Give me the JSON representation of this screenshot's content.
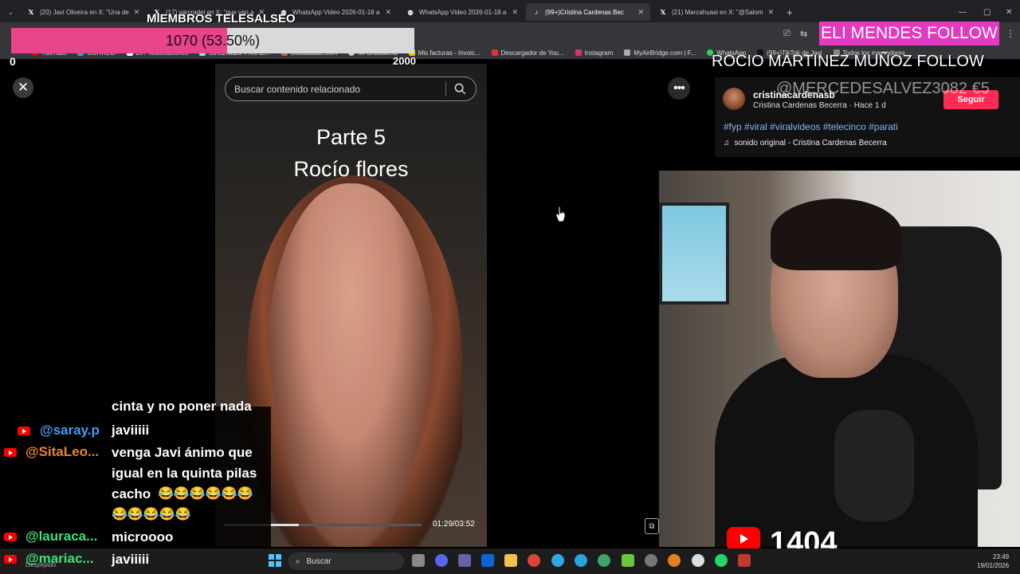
{
  "browser": {
    "tabs": [
      {
        "favicon": "x-logo-icon",
        "title": "(20) Javi Oliveira en X: \"Una de",
        "active": false
      },
      {
        "favicon": "x-logo-icon",
        "title": "(17) varcradel en X: \"que van a",
        "active": false
      },
      {
        "favicon": "globe-icon",
        "title": "WhatsApp Video 2026-01-18 a",
        "active": false
      },
      {
        "favicon": "globe-icon",
        "title": "WhatsApp Video 2026-01-18 a",
        "active": false
      },
      {
        "favicon": "tiktok-icon",
        "title": "(99+)Cristina Cardenas Bec",
        "active": true
      },
      {
        "favicon": "x-logo-icon",
        "title": "(21) Marcahuasi en X: \"@Salom",
        "active": false
      }
    ],
    "bookmarks": [
      "YouTube",
      "CORREO",
      "20+ Notificaciones",
      "Streamlabs: Free Li...",
      "Socialblade.com",
      "Mi Chavalería",
      "Mis facturas - Invoic...",
      "Descargador de You...",
      "Instagram",
      "MyAirBridge.com | F...",
      "WhatsApp",
      "(99+)TikTok de Javi",
      "Todos los marcadores"
    ]
  },
  "overlay": {
    "members_title": "MIEMBROS TELESALSEO",
    "goal_text": "1070 (53.50%)",
    "goal_fraction": 0.535,
    "goal_min": "0",
    "goal_max": "2000",
    "follow_alert": "ELI MENDES  FOLLOW",
    "follow_line": "ROCIO MARTINEZ MUÑOZ  FOLLOW",
    "donation_line": "@MERCEDESALVEZ3082  €5"
  },
  "video": {
    "search_placeholder": "Buscar contenido relacionado",
    "caption_line1": "Parte 5",
    "caption_line2": "Rocío flores",
    "time": "01:29/03:52",
    "progress_fraction": 0.38
  },
  "author": {
    "username": "cristinacardenasb",
    "meta": "Cristina Cardenas Becerra · Hace 1 d",
    "follow_label": "Seguir",
    "hashtags": "#fyp #viral #viralvideos #telecinco #parati",
    "sound": "sonido original - Cristina Cardenas Becerra"
  },
  "stream": {
    "viewers": "1404"
  },
  "chat": {
    "cut_line": "cinta y no poner nada",
    "messages": [
      {
        "user": "@saray.p",
        "color": "#4a9cf5",
        "text": "javiiiii"
      },
      {
        "user": "@SitaLeo...",
        "color": "#e8823a",
        "text": "venga Javi ánimo que igual en la quinta pilas cacho"
      },
      {
        "user": "@lauraca...",
        "color": "#3ee07a",
        "text": "microooo"
      },
      {
        "user": "@mariac...",
        "color": "#3ee07a",
        "text": "javiiiii"
      }
    ],
    "emoji_row1": "😂😂😂😂😂😂",
    "emoji_row2": "😂😂😂😂😂"
  },
  "taskbar": {
    "search_label": "Buscar",
    "weather": "Despejado",
    "time": "23:49",
    "date": "19/01/2026"
  }
}
